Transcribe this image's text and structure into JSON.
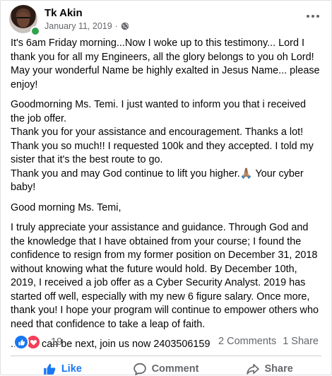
{
  "post": {
    "author": "Tk Akin",
    "date": "January 11, 2019",
    "separator": "·",
    "icons": {
      "privacy": "globe-icon",
      "options": "more-options-icon"
    },
    "paragraphs": [
      "It's 6am Friday morning...Now I woke up to this testimony... Lord I thank you for all my Engineers, all the glory belongs to you oh Lord! May your wonderful Name be highly exalted in Jesus Name... please enjoy!",
      " Goodmorning Ms. Temi. I just wanted to inform you that i received the job offer.\nThank you for your assistance and encouragement. Thanks a lot!\nThank you so much!! I requested 100k and they accepted. I told my sister that it's the best route to go.\nThank you and may God continue to lift you higher.🙏🏽 Your cyber baby!",
      "Good morning Ms. Temi,",
      "I truly appreciate your assistance and guidance. Through God and the knowledge that I have obtained from your course; I found the confidence to resign from my former position on December 31, 2018 without knowing what the future would hold. By December 10th, 2019, I received a job offer as a Cyber Security Analyst. 2019 has started off well, especially with my new 6 figure salary. Once more, thank you! I hope your program will continue to empower others who need that confidence to take a leap of faith.",
      "... You can be next, join us now 2403506159"
    ]
  },
  "engagement": {
    "reaction_count": "19",
    "comments": "2 Comments",
    "shares": "1 Share",
    "reaction_icons": [
      "like-reaction-icon",
      "love-reaction-icon"
    ]
  },
  "actions": {
    "like": "Like",
    "comment": "Comment",
    "share": "Share"
  },
  "colors": {
    "accent": "#1877f2",
    "love": "#f33e58",
    "online": "#31a24c",
    "muted_text": "#65676b"
  }
}
